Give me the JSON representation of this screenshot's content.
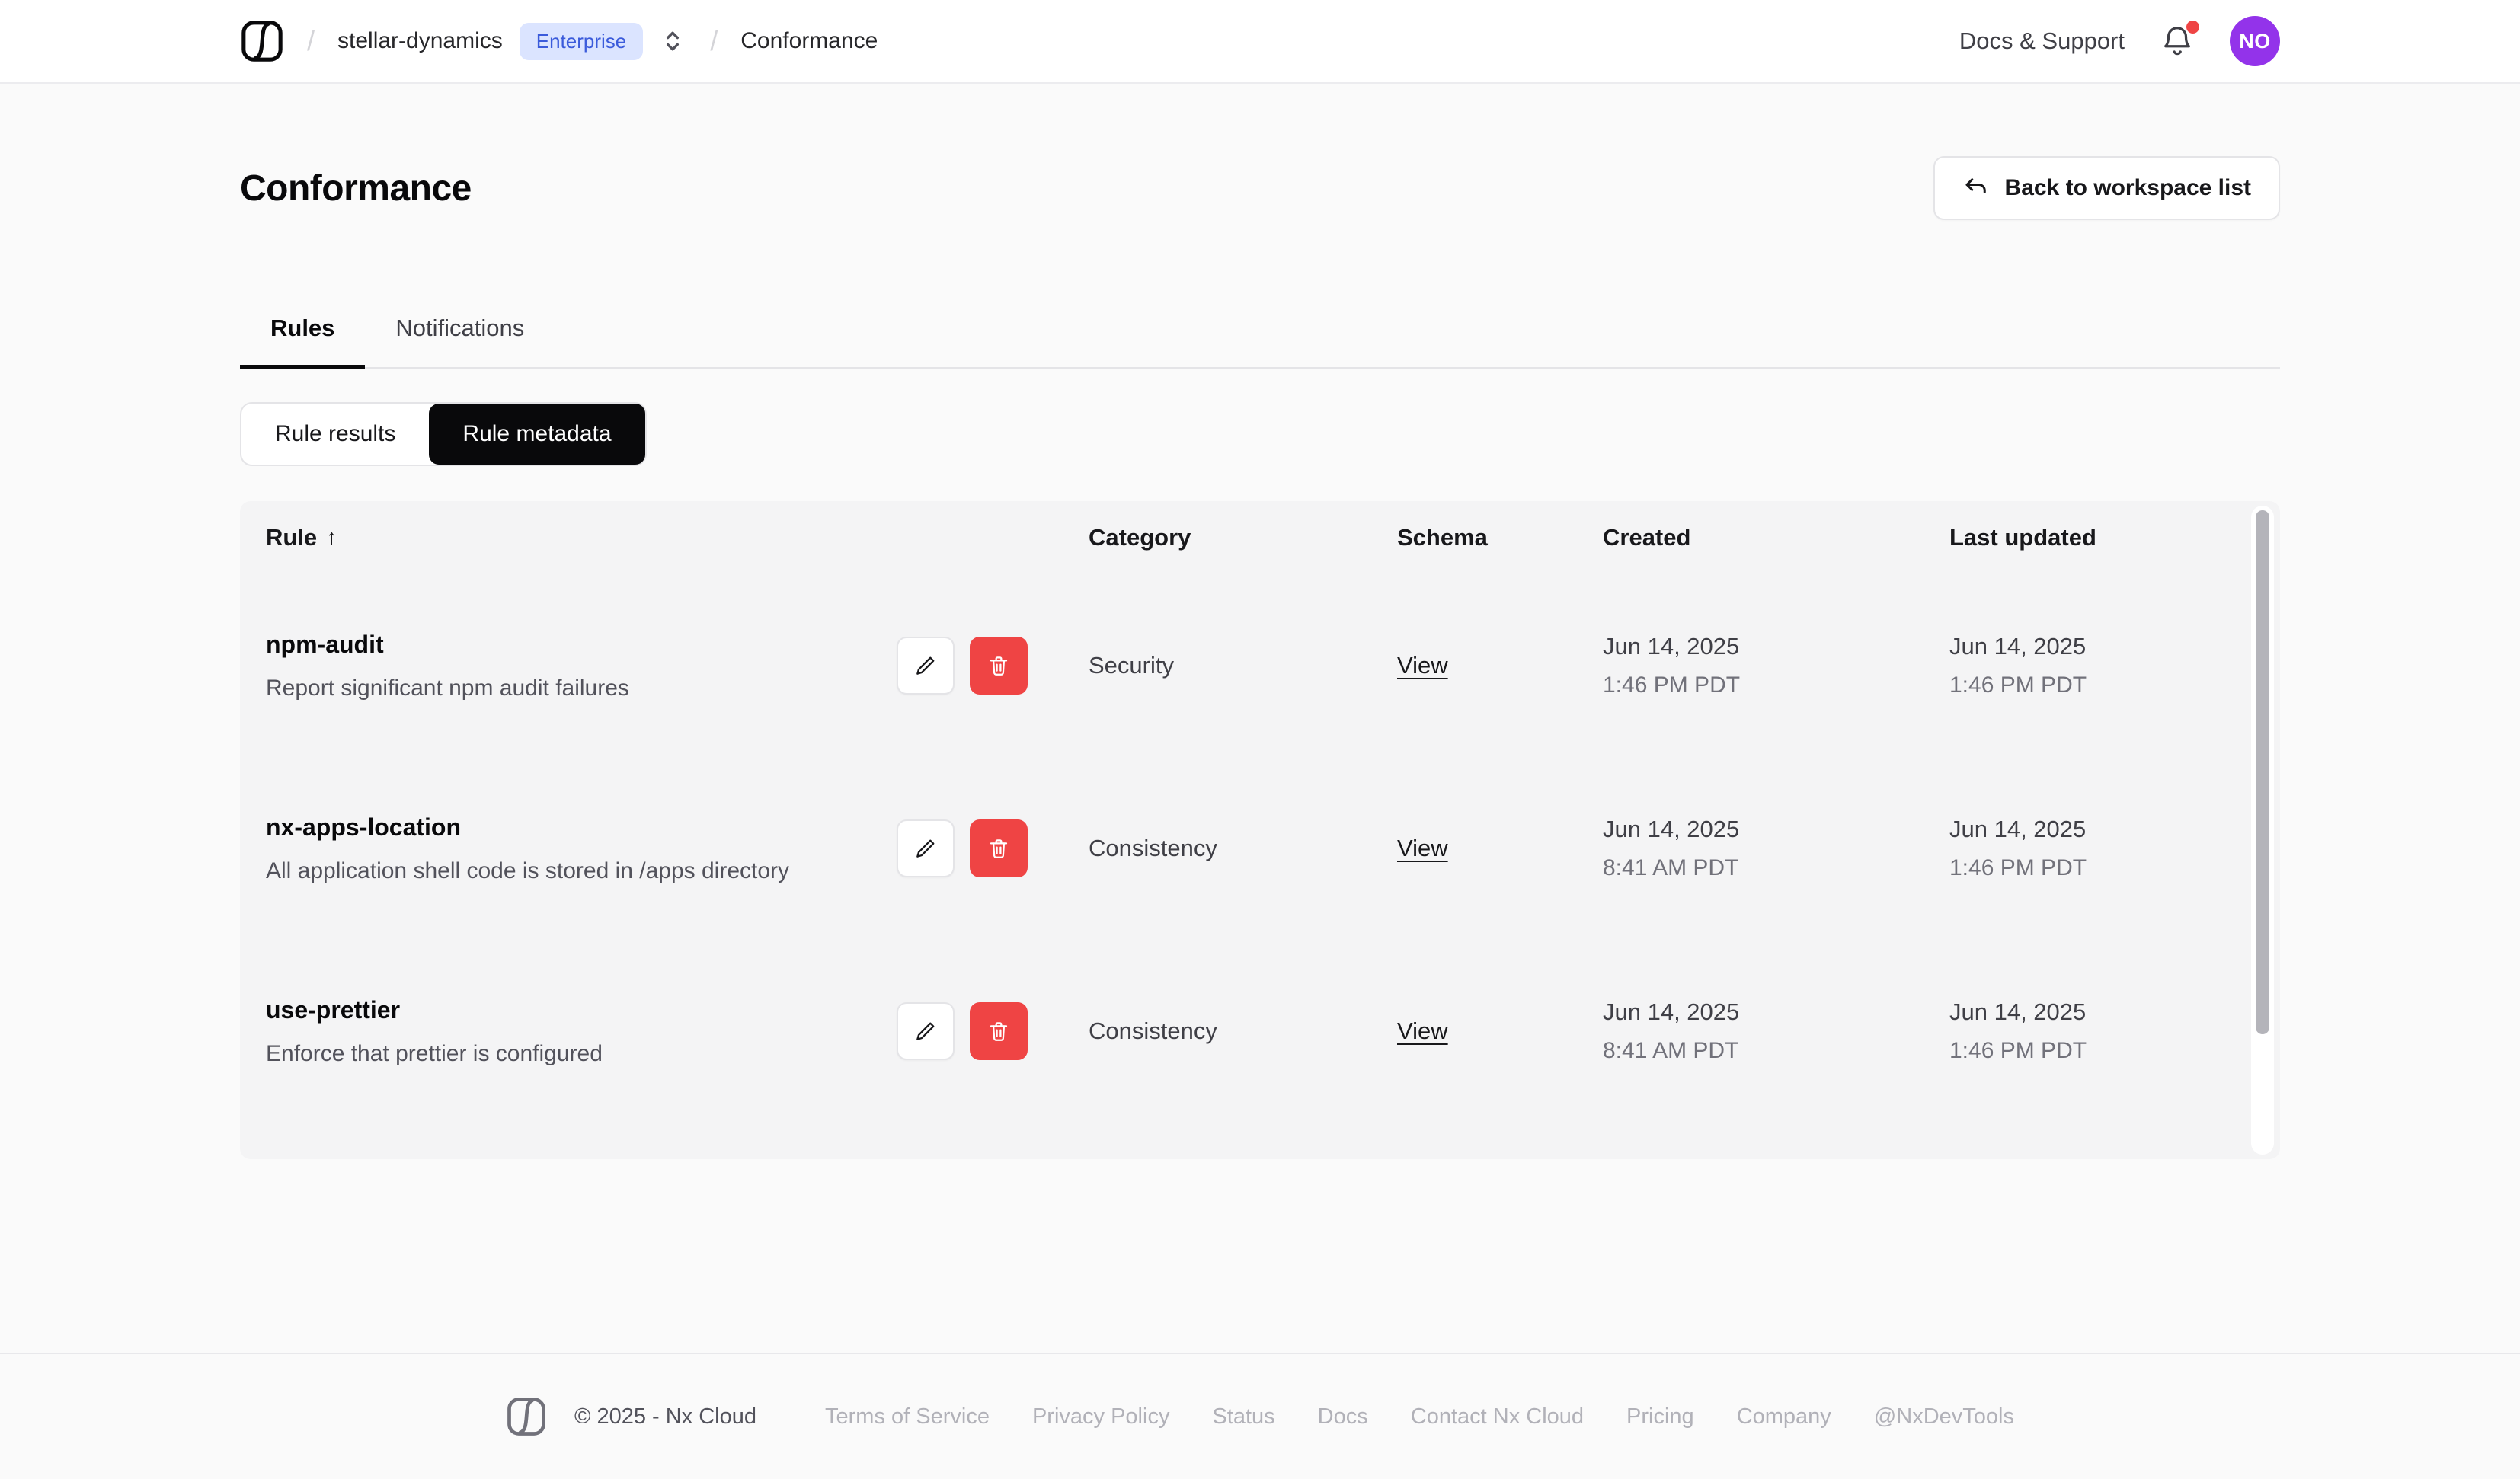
{
  "colors": {
    "badge-bg": "#dbe4ff",
    "badge-text": "#3b5bdb",
    "avatar-bg": "#9333ea",
    "danger": "#ef4444",
    "notification-dot": "#ef4444",
    "active-segment-bg": "#09090b"
  },
  "header": {
    "breadcrumb": {
      "separator": "/",
      "workspace": "stellar-dynamics",
      "badge": "Enterprise",
      "page": "Conformance"
    },
    "docs_support_label": "Docs & Support",
    "avatar_initials": "NO"
  },
  "page": {
    "title": "Conformance",
    "back_button_label": "Back to workspace list"
  },
  "tabs": {
    "rules": "Rules",
    "notifications": "Notifications"
  },
  "view_toggle": {
    "rule_results": "Rule results",
    "rule_metadata": "Rule metadata"
  },
  "table": {
    "columns": [
      "Rule",
      "Category",
      "Schema",
      "Created",
      "Last updated"
    ],
    "sort_arrow": "↑",
    "rows": [
      {
        "name": "npm-audit",
        "description": "Report significant npm audit failures",
        "category": "Security",
        "schema_link": "View",
        "created_date": "Jun 14, 2025",
        "created_time": "1:46 PM PDT",
        "updated_date": "Jun 14, 2025",
        "updated_time": "1:46 PM PDT"
      },
      {
        "name": "nx-apps-location",
        "description": "All application shell code is stored in /apps directory",
        "category": "Consistency",
        "schema_link": "View",
        "created_date": "Jun 14, 2025",
        "created_time": "8:41 AM PDT",
        "updated_date": "Jun 14, 2025",
        "updated_time": "1:46 PM PDT"
      },
      {
        "name": "use-prettier",
        "description": "Enforce that prettier is configured",
        "category": "Consistency",
        "schema_link": "View",
        "created_date": "Jun 14, 2025",
        "created_time": "8:41 AM PDT",
        "updated_date": "Jun 14, 2025",
        "updated_time": "1:46 PM PDT"
      }
    ]
  },
  "footer": {
    "copyright": "© 2025 - Nx Cloud",
    "links": [
      "Terms of Service",
      "Privacy Policy",
      "Status",
      "Docs",
      "Contact Nx Cloud",
      "Pricing",
      "Company",
      "@NxDevTools"
    ]
  }
}
